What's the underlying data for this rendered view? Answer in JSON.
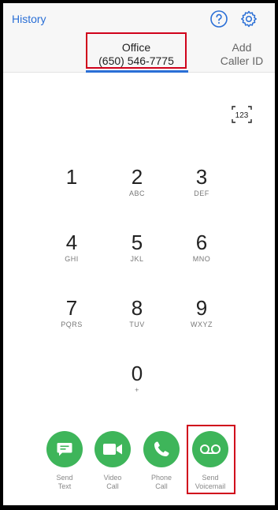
{
  "header": {
    "history_label": "History",
    "help_icon": "question-circle-icon",
    "settings_icon": "gear-icon",
    "accent_color": "#2a6fd6"
  },
  "tabs": {
    "office": {
      "title": "Office",
      "number": "(650) 546-7775"
    },
    "add_caller_id": {
      "line1": "Add",
      "line2": "Caller ID"
    }
  },
  "keypad": {
    "toggle_label": "123",
    "keys": [
      {
        "digit": "1",
        "letters": ""
      },
      {
        "digit": "2",
        "letters": "ABC"
      },
      {
        "digit": "3",
        "letters": "DEF"
      },
      {
        "digit": "4",
        "letters": "GHI"
      },
      {
        "digit": "5",
        "letters": "JKL"
      },
      {
        "digit": "6",
        "letters": "MNO"
      },
      {
        "digit": "7",
        "letters": "PQRS"
      },
      {
        "digit": "8",
        "letters": "TUV"
      },
      {
        "digit": "9",
        "letters": "WXYZ"
      },
      {
        "digit": "0",
        "letters": "+"
      }
    ]
  },
  "actions": {
    "color": "#3eb55a",
    "send_text": {
      "line1": "Send",
      "line2": "Text"
    },
    "video_call": {
      "line1": "Video",
      "line2": "Call"
    },
    "phone_call": {
      "line1": "Phone",
      "line2": "Call"
    },
    "send_voicemail": {
      "line1": "Send",
      "line2": "Voicemail"
    }
  }
}
